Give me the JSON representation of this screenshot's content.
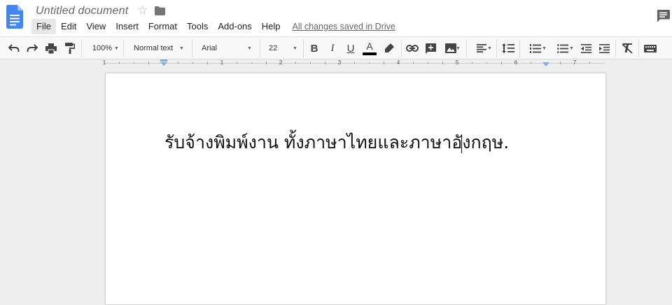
{
  "app": {
    "doc_title": "Untitled document",
    "save_status": "All changes saved in Drive"
  },
  "menu": [
    "File",
    "Edit",
    "View",
    "Insert",
    "Format",
    "Tools",
    "Add-ons",
    "Help"
  ],
  "toolbar": {
    "zoom": "100%",
    "style": "Normal text",
    "font": "Arial",
    "font_size": "22"
  },
  "ruler": {
    "numbers": [
      "1",
      "1",
      "2",
      "3",
      "4",
      "5",
      "6",
      "7"
    ]
  },
  "document": {
    "text": "รับจ้างพิมพ์งาน ทั้งภาษาไทยและภาษาอังกฤษ."
  },
  "colors": {
    "brand": "#4285f4",
    "text_color_bar": "#000000"
  }
}
